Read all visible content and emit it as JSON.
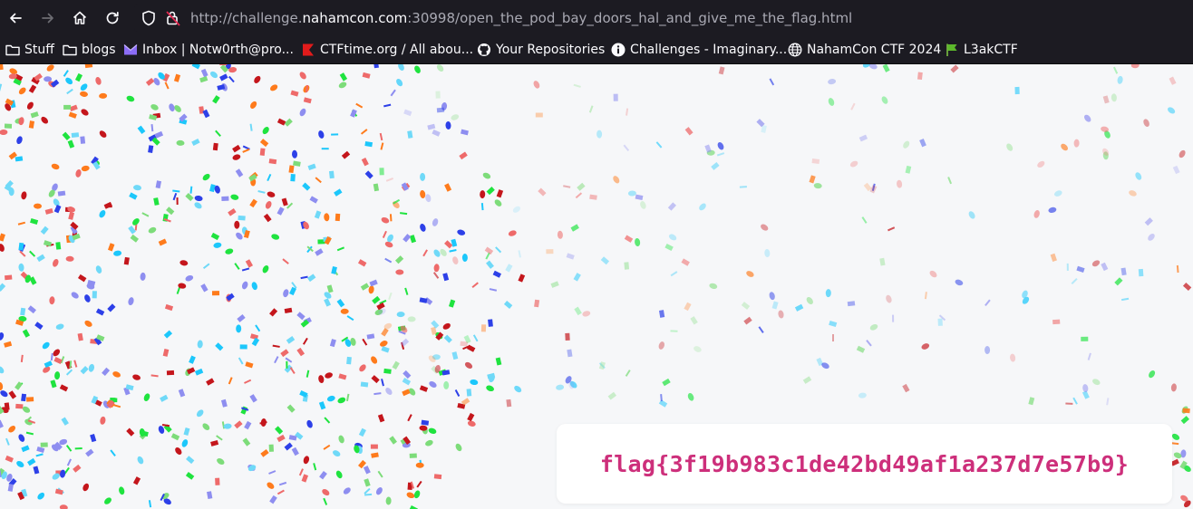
{
  "browser": {
    "url_prefix": "http://challenge.",
    "url_host": "nahamcon.com",
    "url_suffix": ":30998/open_the_pod_bay_doors_hal_and_give_me_the_flag.html"
  },
  "bookmarks": [
    {
      "label": "Stuff",
      "icon": "folder-icon"
    },
    {
      "label": "blogs",
      "icon": "folder-icon"
    },
    {
      "label": "Inbox | Notw0rth@pro...",
      "icon": "proton-mail-icon"
    },
    {
      "label": "CTFtime.org / All abou...",
      "icon": "ctftime-flag-icon"
    },
    {
      "label": "Your Repositories",
      "icon": "github-icon"
    },
    {
      "label": "Challenges - Imaginary...",
      "icon": "info-icon"
    },
    {
      "label": "NahamCon CTF 2024",
      "icon": "globe-icon"
    },
    {
      "label": "L3akCTF",
      "icon": "green-flag-icon"
    }
  ],
  "page": {
    "flag": "flag{3f19b983c1de42bd49af1a237d7e57b9}"
  },
  "colors": {
    "flag_text": "#cd2f7b",
    "page_bg": "#f6f7f9",
    "chrome_bg": "#1c1b22",
    "confetti": [
      "#c4161c",
      "#1fe33f",
      "#2d40e8",
      "#fe7b1c",
      "#1cc7fb",
      "#ee6a6a",
      "#8e8ef0",
      "#6fd9f8",
      "#7ddc7a"
    ]
  }
}
